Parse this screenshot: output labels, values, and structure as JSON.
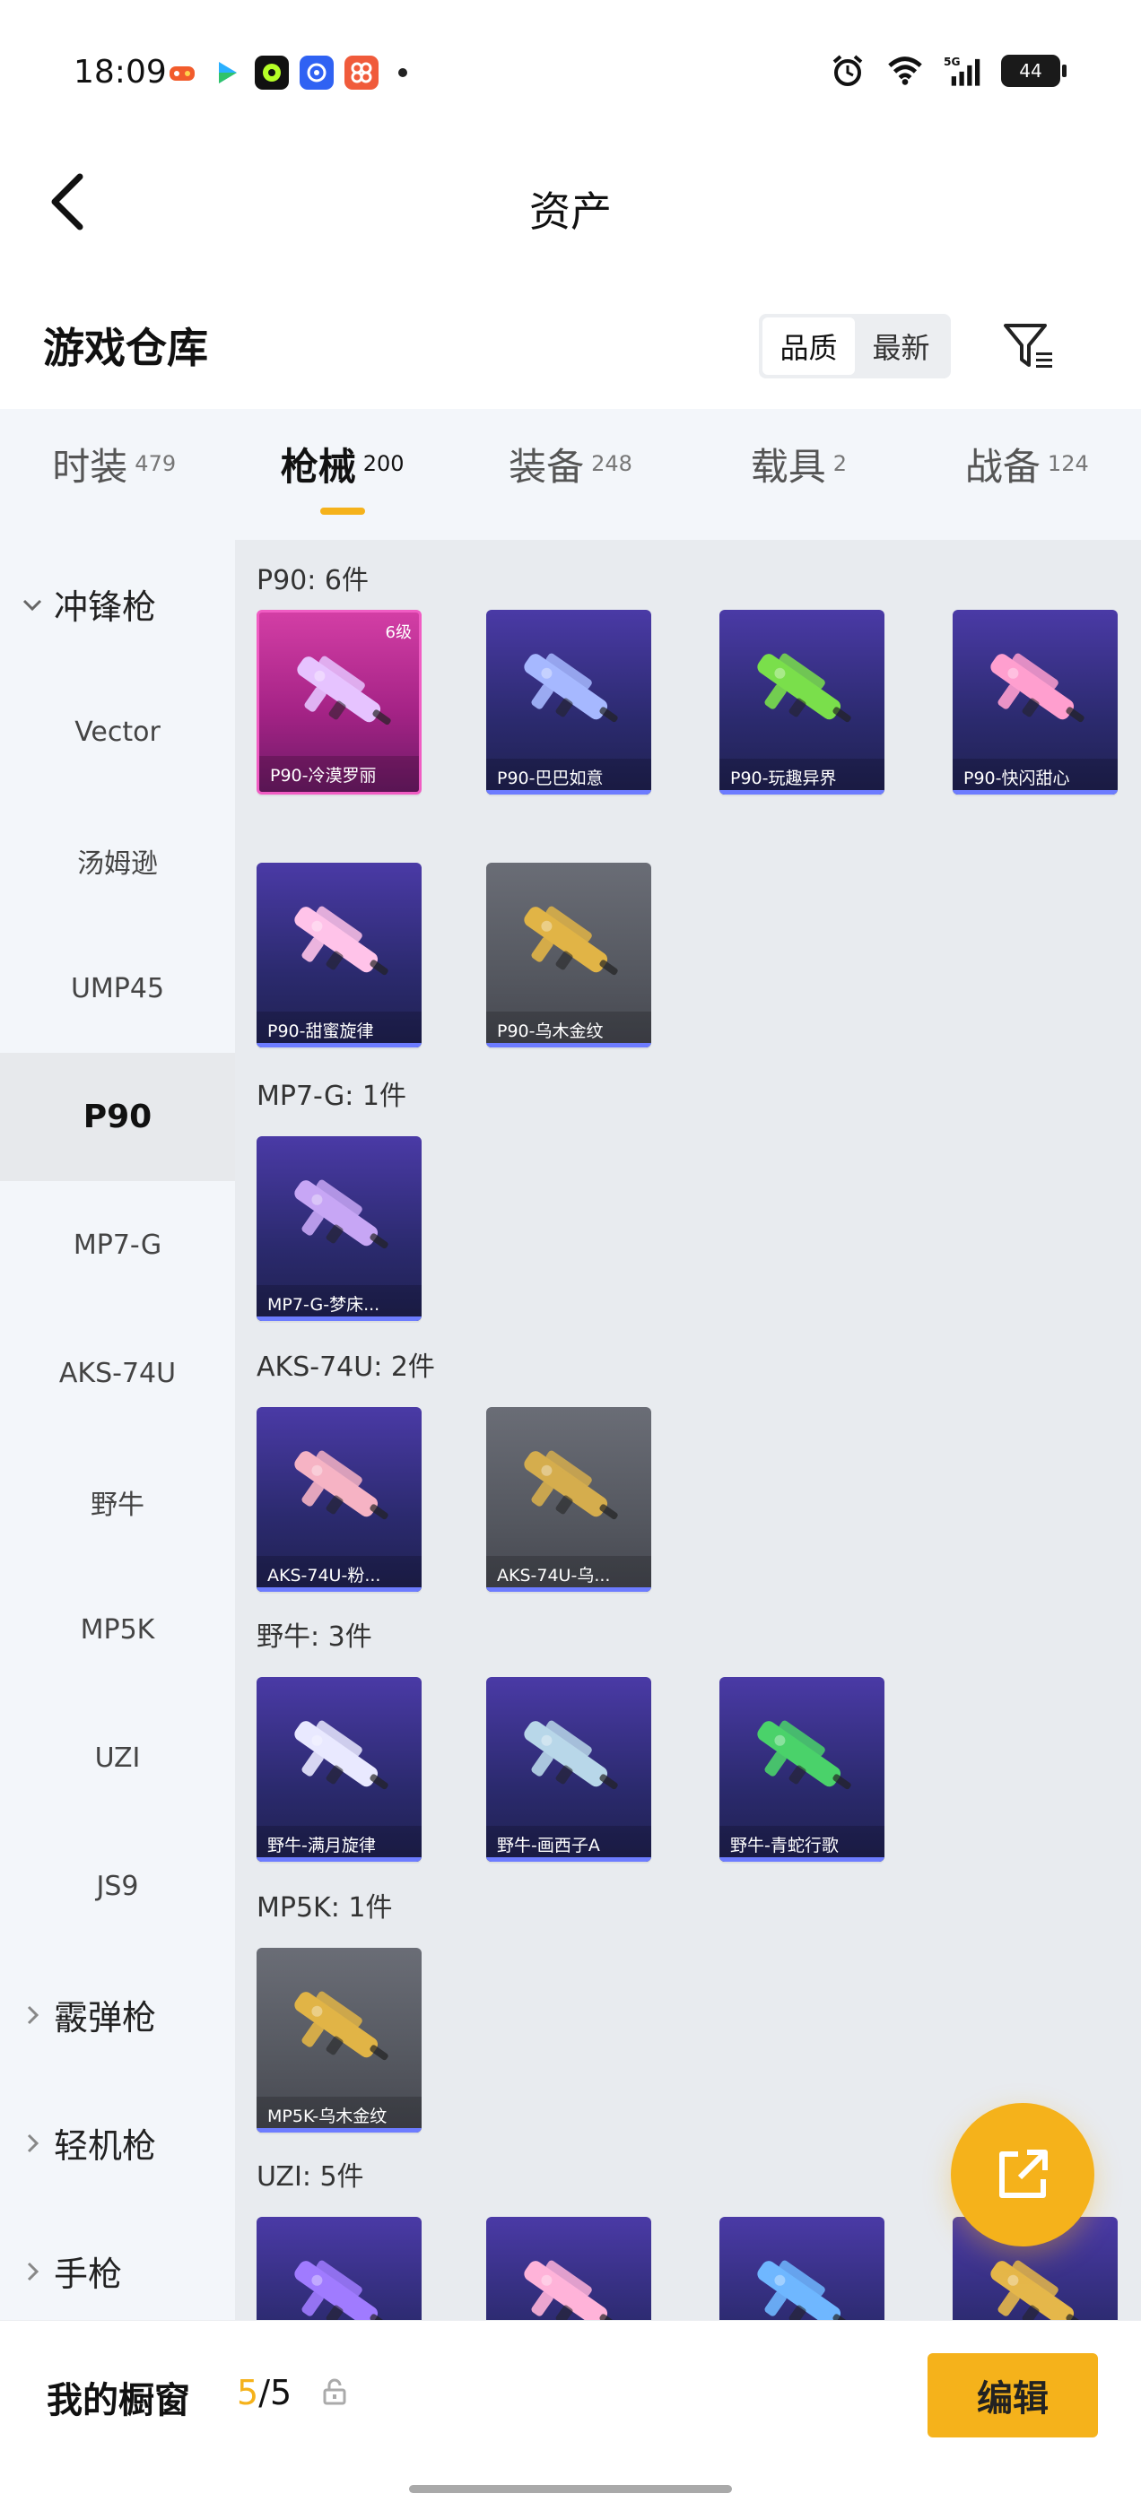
{
  "status_bar": {
    "time": "18:09",
    "app_icons": [
      "game-icon",
      "video-icon",
      "camera-icon",
      "browser-icon",
      "chat-icon"
    ],
    "battery": "44"
  },
  "header": {
    "title": "资产"
  },
  "warehouse": {
    "title": "游戏仓库",
    "sort_options": [
      "品质",
      "最新"
    ],
    "active_sort": 0
  },
  "tabs": [
    {
      "label": "时装",
      "count": "479"
    },
    {
      "label": "枪械",
      "count": "200"
    },
    {
      "label": "装备",
      "count": "248"
    },
    {
      "label": "载具",
      "count": "2"
    },
    {
      "label": "战备",
      "count": "124"
    }
  ],
  "active_tab": 1,
  "sidebar": {
    "group_open": "冲锋枪",
    "items": [
      "Vector",
      "汤姆逊",
      "UMP45",
      "P90",
      "MP7-G",
      "AKS-74U",
      "野牛",
      "MP5K",
      "UZI",
      "JS9"
    ],
    "active_item": "P90",
    "collapsed_groups": [
      "霰弹枪",
      "轻机枪",
      "手枪"
    ]
  },
  "sections": [
    {
      "title": "P90: 6件",
      "items": [
        {
          "name": "P90-冷漠罗丽",
          "style": "pink",
          "level": "6级",
          "color": "#e6c3ff"
        },
        {
          "name": "P90-巴巴如意",
          "style": "blue",
          "color": "#a6b8ff"
        },
        {
          "name": "P90-玩趣异界",
          "style": "blue",
          "color": "#7adf4b"
        },
        {
          "name": "P90-快闪甜心",
          "style": "blue",
          "color": "#ff9fcf"
        },
        {
          "name": "P90-甜蜜旋律",
          "style": "blue",
          "color": "#ffc3e9"
        },
        {
          "name": "P90-乌木金纹",
          "style": "gray",
          "color": "#e1b446"
        }
      ]
    },
    {
      "title": "MP7-G: 1件",
      "items": [
        {
          "name": "MP7-G-梦床...",
          "style": "blue",
          "color": "#c7a6f5"
        }
      ]
    },
    {
      "title": "AKS-74U: 2件",
      "items": [
        {
          "name": "AKS-74U-粉...",
          "style": "blue",
          "color": "#f6b3c4"
        },
        {
          "name": "AKS-74U-乌...",
          "style": "gray",
          "color": "#d5ad4d"
        }
      ]
    },
    {
      "title": "野牛: 3件",
      "items": [
        {
          "name": "野牛-满月旋律",
          "style": "blue",
          "color": "#e9e9ff"
        },
        {
          "name": "野牛-画西子A",
          "style": "blue",
          "color": "#b8d7e9"
        },
        {
          "name": "野牛-青蛇行歌",
          "style": "blue",
          "color": "#4ad26a"
        }
      ]
    },
    {
      "title": "MP5K: 1件",
      "items": [
        {
          "name": "MP5K-乌木金纹",
          "style": "gray",
          "color": "#e1b446"
        }
      ]
    },
    {
      "title": "UZI: 5件",
      "items": [
        {
          "name": "",
          "style": "blue",
          "color": "#a07bff"
        },
        {
          "name": "",
          "style": "blue",
          "color": "#ffb3d9"
        },
        {
          "name": "",
          "style": "blue",
          "color": "#6fb7ff"
        },
        {
          "name": "",
          "style": "blue",
          "color": "#e5b74a"
        }
      ]
    }
  ],
  "showcase": {
    "label": "我的橱窗",
    "current": "5",
    "total": "/5"
  },
  "edit_button": "编辑",
  "accent_color": "#f5b21b"
}
